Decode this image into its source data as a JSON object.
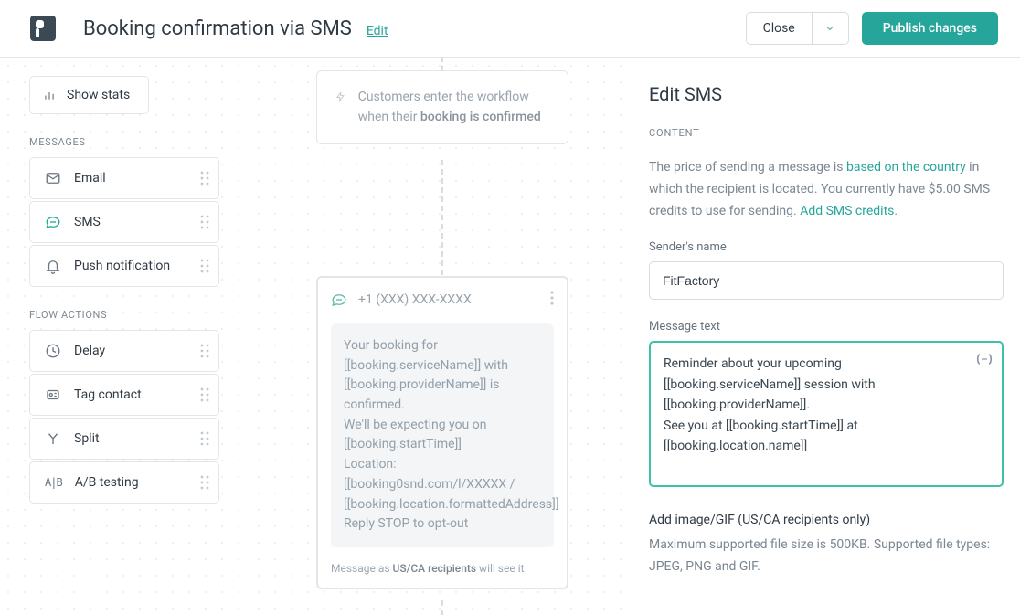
{
  "header": {
    "title": "Booking confirmation via SMS",
    "edit_label": "Edit",
    "close_label": "Close",
    "publish_label": "Publish changes"
  },
  "sidebar": {
    "show_stats_label": "Show stats",
    "messages_title": "MESSAGES",
    "flow_actions_title": "FLOW ACTIONS",
    "messages": [
      {
        "label": "Email"
      },
      {
        "label": "SMS"
      },
      {
        "label": "Push notification"
      }
    ],
    "flow_actions": [
      {
        "label": "Delay"
      },
      {
        "label": "Tag contact"
      },
      {
        "label": "Split"
      },
      {
        "label": "A/B testing"
      }
    ]
  },
  "canvas": {
    "trigger_prefix": "Customers enter the workflow when their ",
    "trigger_strong": "booking is confirmed",
    "sms_number": "+1 (XXX) XXX-XXXX",
    "sms_body": "Your booking for [[booking.serviceName]] with [[booking.providerName]] is confirmed.\nWe'll be expecting you on [[booking.startTime]]\nLocation: [[booking0snd.com/l/XXXXX / [[booking.location.formattedAddress]]\nReply STOP to opt-out",
    "sms_foot_prefix": "Message as ",
    "sms_foot_mid": "US/CA recipients",
    "sms_foot_suffix": " will see it"
  },
  "panel": {
    "title": "Edit SMS",
    "content_label": "CONTENT",
    "desc_pre": "The price of sending a message is ",
    "desc_link1": "based on the country",
    "desc_mid": " in which the recipient is located. You currently have $5.00 SMS credits to use for sending. ",
    "desc_link2": "Add SMS credits",
    "desc_end": ".",
    "sender_label": "Sender's name",
    "sender_value": "FitFactory",
    "message_label": "Message text",
    "message_value": "Reminder about your upcoming [[booking.serviceName]] session with [[booking.providerName]].\nSee you at [[booking.startTime]] at [[booking.location.name]]",
    "attach_label": "Add image/GIF (US/CA recipients only)",
    "attach_hint": "Maximum supported file size is 500KB. Supported file types: JPEG, PNG and GIF."
  }
}
